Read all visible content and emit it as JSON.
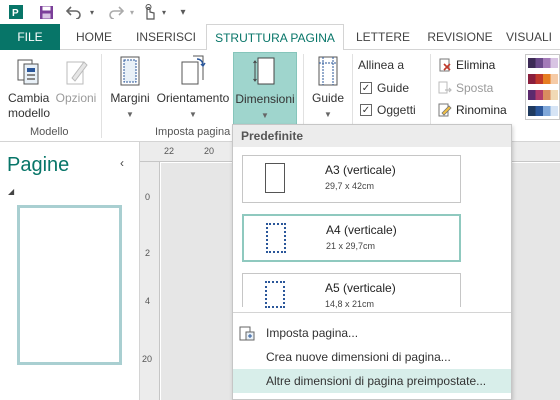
{
  "qat": {
    "file_icon": "file-app-icon",
    "save_icon": "save-icon",
    "undo_icon": "undo-icon",
    "redo_icon": "redo-icon",
    "touch_icon": "touch-mode-icon",
    "customize_icon": "customize-qat-icon"
  },
  "tabs": {
    "file": "FILE",
    "home": "HOME",
    "insert": "INSERISCI",
    "page_design": "STRUTTURA PAGINA",
    "mailings": "LETTERE",
    "review": "REVISIONE",
    "view": "VISUALI"
  },
  "ribbon": {
    "change_template": "Cambia modello",
    "options": "Opzioni",
    "margins": "Margini",
    "orientation": "Orientamento",
    "size": "Dimensioni",
    "guides": "Guide",
    "align_to": "Allinea a",
    "check_guides": "Guide",
    "check_objects": "Oggetti",
    "delete": "Elimina",
    "move": "Sposta",
    "rename": "Rinomina",
    "group_template": "Modello",
    "group_page_setup": "Imposta pagina",
    "checkbox_mark": "✓"
  },
  "pages_pane": {
    "title": "Pagine",
    "collapse": "‹",
    "expand_arrow": "◢"
  },
  "ruler": {
    "top": [
      "22",
      "20"
    ],
    "left": [
      "0",
      "2",
      "4",
      "20"
    ]
  },
  "dropdown": {
    "header": "Predefinite",
    "options": [
      {
        "name": "A3 (verticale)",
        "dim": "29,7 x 42cm"
      },
      {
        "name": "A4 (verticale)",
        "dim": "21 x 29,7cm"
      },
      {
        "name": "A5 (verticale)",
        "dim": "14,8 x 21cm"
      }
    ],
    "commands": [
      {
        "label": "Imposta pagina..."
      },
      {
        "label": "Crea nuove dimensioni di pagina..."
      },
      {
        "label": "Altre dimensioni di pagina preimpostate..."
      }
    ]
  },
  "colors": {
    "accent": "#077568",
    "ribbon_pressed": "#9fd5cd",
    "hover": "#d8eeea",
    "selected_border": "#8fc9bf",
    "canvas": "#e6e6e6"
  }
}
